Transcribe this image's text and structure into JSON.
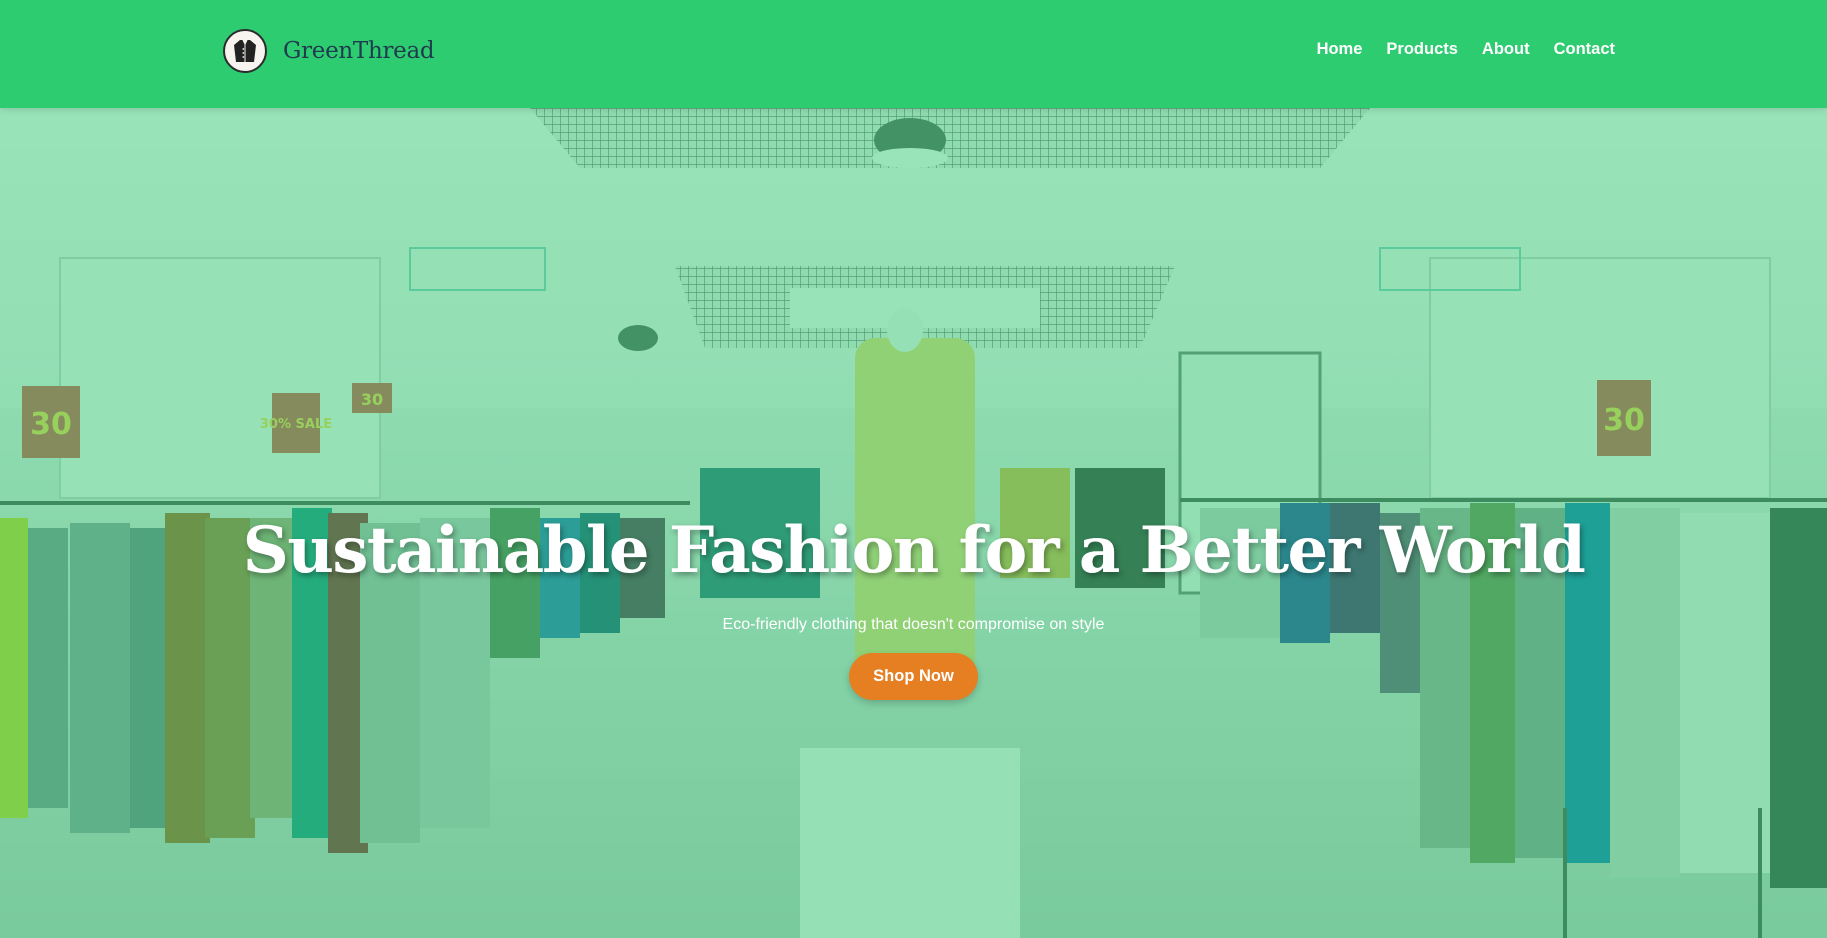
{
  "brand": {
    "name": "GreenThread",
    "logo_icon": "jacket-icon"
  },
  "nav": {
    "items": [
      {
        "label": "Home"
      },
      {
        "label": "Products"
      },
      {
        "label": "About"
      },
      {
        "label": "Contact"
      }
    ]
  },
  "hero": {
    "title": "Sustainable Fashion for a Better World",
    "subtitle": "Eco-friendly clothing that doesn't compromise on style",
    "cta_label": "Shop Now",
    "sale_signs": [
      "30",
      "30% SALE",
      "30",
      "30"
    ]
  },
  "colors": {
    "header_bg": "#2ecc71",
    "overlay": "#2ecc71",
    "cta_bg": "#e67e22",
    "brand_text": "#1f3b4d"
  }
}
